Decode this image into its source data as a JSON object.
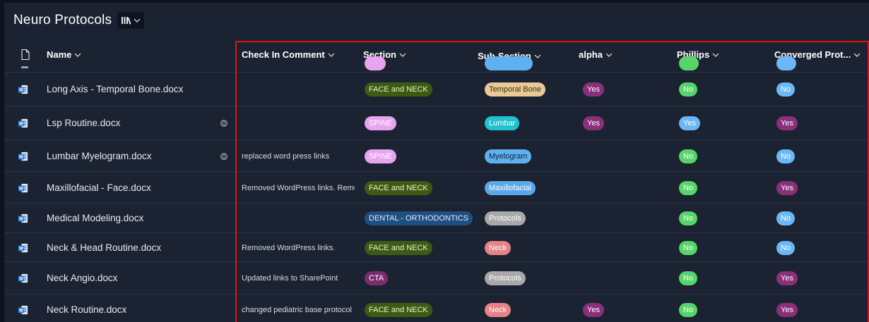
{
  "library": {
    "title": "Neuro Protocols"
  },
  "columns": {
    "name": "Name",
    "check_in_comment": "Check In Comment",
    "section": "Section",
    "sub_section": "Sub-Section",
    "alpha": "alpha",
    "phillips": "Phillips",
    "converged": "Converged Prot..."
  },
  "rows": [
    {
      "name": "Long Axis - Temporal Bone.docx",
      "comment": "",
      "section": "FACE and NECK",
      "sub_section": "Temporal Bone",
      "alpha": "Yes",
      "phillips": "No",
      "converged": "No"
    },
    {
      "name": "Lsp Routine.docx",
      "comment": "",
      "section": "SPINE",
      "sub_section": "Lumbar",
      "alpha": "Yes",
      "phillips": "Yes",
      "converged": "Yes"
    },
    {
      "name": "Lumbar Myelogram.docx",
      "comment": "replaced word press links",
      "section": "SPINE",
      "sub_section": "Myelogram",
      "alpha": "",
      "phillips": "No",
      "converged": "No"
    },
    {
      "name": "Maxillofacial - Face.docx",
      "comment": "Removed WordPress links. Remo",
      "section": "FACE and NECK",
      "sub_section": "Maxillofacial",
      "alpha": "",
      "phillips": "No",
      "converged": "Yes"
    },
    {
      "name": "Medical Modeling.docx",
      "comment": "",
      "section": "DENTAL - ORTHODONTICS",
      "sub_section": "Protocols",
      "alpha": "",
      "phillips": "No",
      "converged": "No"
    },
    {
      "name": "Neck & Head Routine.docx",
      "comment": "Removed WordPress links.",
      "section": "FACE and NECK",
      "sub_section": "Neck",
      "alpha": "",
      "phillips": "No",
      "converged": "No"
    },
    {
      "name": "Neck Angio.docx",
      "comment": "Updated links to SharePoint",
      "section": "CTA",
      "sub_section": "Protocols",
      "alpha": "",
      "phillips": "No",
      "converged": "Yes"
    },
    {
      "name": "Neck Routine.docx",
      "comment": "changed pediatric base protocol",
      "section": "FACE and NECK",
      "sub_section": "Neck",
      "alpha": "Yes",
      "phillips": "No",
      "converged": "Yes"
    }
  ],
  "colors": {
    "background": "#1b2332",
    "highlight_border": "#e01010",
    "word_icon": "#2b7cd3"
  },
  "icons": {
    "file_type": "document-icon",
    "word": "word-file-icon",
    "sync": "sync-status-icon",
    "view": "library-view-icon"
  }
}
